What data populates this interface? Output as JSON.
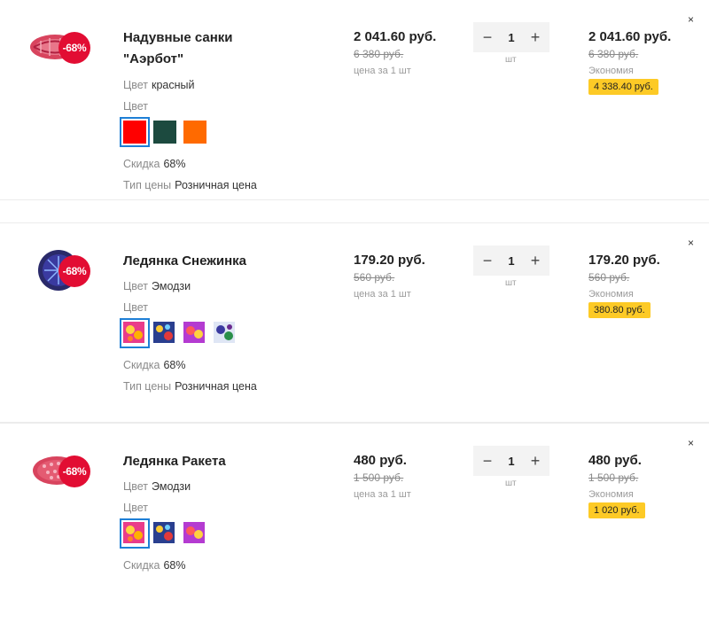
{
  "items": [
    {
      "name": "Надувные санки \"Аэрбот\"",
      "discount_badge": "-68%",
      "color_label": "Цвет",
      "color_value": "красный",
      "color_choice_label": "Цвет",
      "discount_label": "Скидка",
      "discount_value": "68%",
      "price_type_label": "Тип цены",
      "price_type_value": "Розничная цена",
      "price": "2 041.60 руб.",
      "old_price": "6 380 руб.",
      "per_unit": "цена за 1 шт",
      "quantity": "1",
      "unit": "шт",
      "total_price": "2 041.60 руб.",
      "total_old_price": "6 380 руб.",
      "savings_label": "Экономия",
      "savings": "4 338.40 руб.",
      "swatch_colors": [
        "#ff0000",
        "#1c4a3f",
        "#ff6a00"
      ]
    },
    {
      "name": "Ледянка Снежинка",
      "discount_badge": "-68%",
      "color_label": "Цвет",
      "color_value": "Эмодзи",
      "color_choice_label": "Цвет",
      "discount_label": "Скидка",
      "discount_value": "68%",
      "price_type_label": "Тип цены",
      "price_type_value": "Розничная цена",
      "price": "179.20 руб.",
      "old_price": "560 руб.",
      "per_unit": "цена за 1 шт",
      "quantity": "1",
      "unit": "шт",
      "total_price": "179.20 руб.",
      "total_old_price": "560 руб.",
      "savings_label": "Экономия",
      "savings": "380.80 руб."
    },
    {
      "name": "Ледянка Ракета",
      "discount_badge": "-68%",
      "color_label": "Цвет",
      "color_value": "Эмодзи",
      "color_choice_label": "Цвет",
      "discount_label": "Скидка",
      "discount_value": "68%",
      "price": "480 руб.",
      "old_price": "1 500 руб.",
      "per_unit": "цена за 1 шт",
      "quantity": "1",
      "unit": "шт",
      "total_price": "480 руб.",
      "total_old_price": "1 500 руб.",
      "savings_label": "Экономия",
      "savings": "1 020 руб."
    }
  ],
  "controls": {
    "minus": "−",
    "plus": "+",
    "remove": "×"
  }
}
